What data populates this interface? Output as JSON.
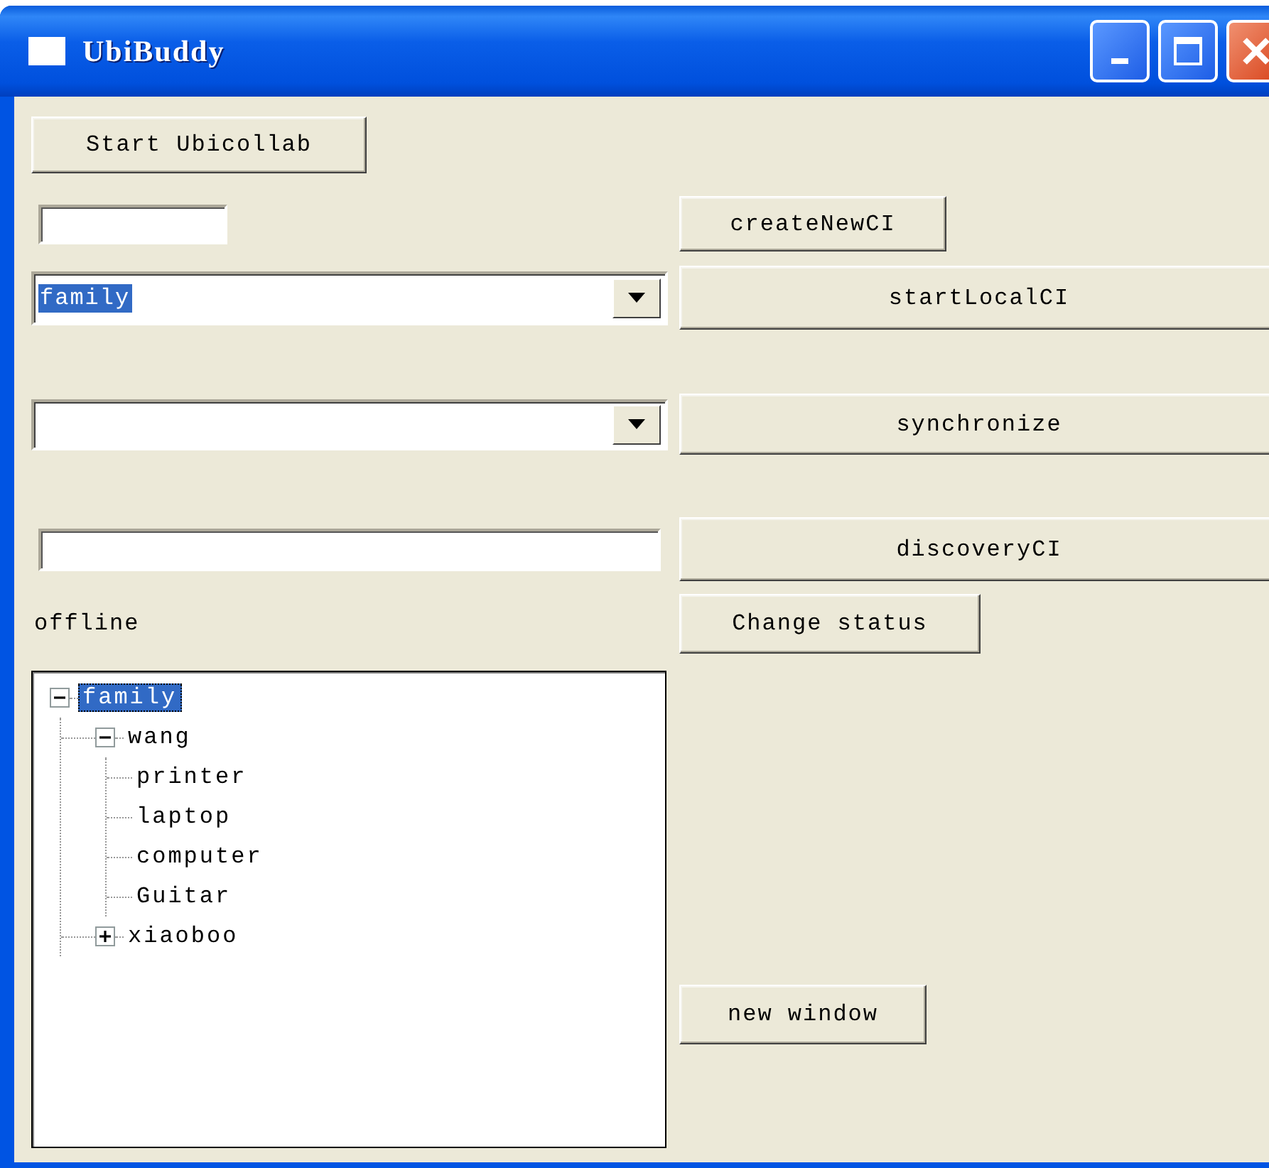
{
  "window": {
    "title": "UbiBuddy"
  },
  "start_button": {
    "label": "Start Ubicollab"
  },
  "create_button": {
    "label": "createNewCI"
  },
  "ci_combo": {
    "value": "family",
    "highlighted": true
  },
  "start_local_button": {
    "label": "startLocalCI"
  },
  "synchronize_button": {
    "label": "synchronize"
  },
  "discovery_button": {
    "label": "discoveryCI"
  },
  "status": "offline",
  "change_status_button": {
    "label": "Change status"
  },
  "tree": [
    {
      "label": "family",
      "selected": true,
      "expanded": true,
      "children": [
        {
          "label": "wang",
          "selected": false,
          "expanded": true,
          "children": [
            {
              "label": "printer",
              "selected": false
            },
            {
              "label": "laptop",
              "selected": false
            },
            {
              "label": "computer",
              "selected": false
            },
            {
              "label": "Guitar",
              "selected": false
            }
          ]
        },
        {
          "label": "xiaoboo",
          "selected": false,
          "expanded": false
        }
      ]
    }
  ],
  "new_window_button": {
    "label": "new window"
  }
}
